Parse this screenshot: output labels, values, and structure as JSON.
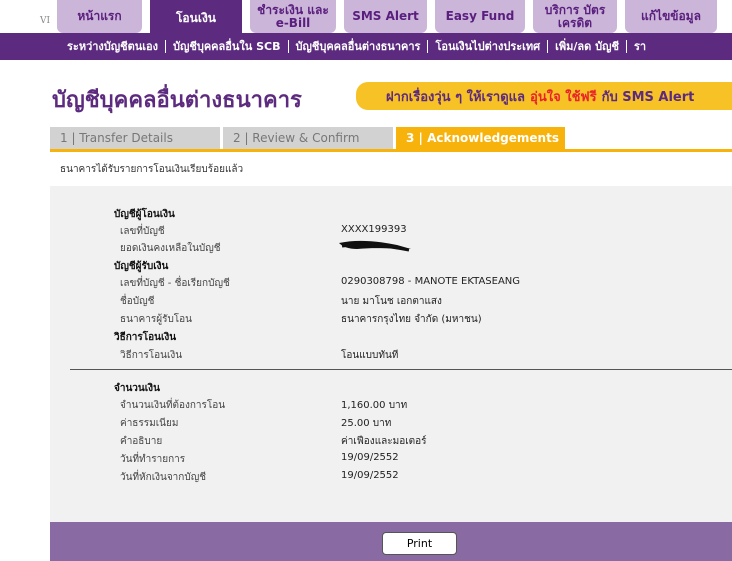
{
  "top_nav": {
    "corner_label": "VI",
    "tabs": [
      {
        "label": "หน้าแรก"
      },
      {
        "label": "โอนเงิน"
      },
      {
        "label": "ชำระเงิน และ e-Bill"
      },
      {
        "label": "SMS Alert"
      },
      {
        "label": "Easy Fund"
      },
      {
        "label": "บริการ บัตรเครดิต"
      },
      {
        "label": "แก้ไขข้อมูล"
      }
    ]
  },
  "sub_nav": {
    "items": [
      {
        "label": "ระหว่างบัญชีตนเอง"
      },
      {
        "label": "บัญชีบุคคลอื่นใน SCB"
      },
      {
        "label": "บัญชีบุคคลอื่นต่างธนาคาร"
      },
      {
        "label": "โอนเงินไปต่างประเทศ"
      },
      {
        "label": "เพิ่ม/ลด บัญชี"
      },
      {
        "label": "รา"
      }
    ]
  },
  "page_title": "บัญชีบุคคลอื่นต่างธนาคาร",
  "banner": {
    "text_before": "ฝากเรื่องวุ่น ๆ ให้เราดูแล",
    "highlight": "อุ่นใจ ใช้ฟรี",
    "text_after": "กับ SMS Alert"
  },
  "steps": [
    {
      "label": "1 | Transfer Details"
    },
    {
      "label": "2 | Review & Confirm"
    },
    {
      "label": "3 | Acknowledgements"
    }
  ],
  "success_message": "ธนาคารได้รับรายการโอนเงินเรียบร้อยแล้ว",
  "details": {
    "from_title": "บัญชีผู้โอนเงิน",
    "from_account_label": "เลขที่บัญชี",
    "from_account_value": "XXXX199393",
    "balance_label": "ยอดเงินคงเหลือในบัญชี",
    "to_title": "บัญชีผู้รับเงิน",
    "to_account_label": "เลขที่บัญชี - ชื่อเรียกบัญชี",
    "to_account_value": "0290308798 - MANOTE EKTASEANG",
    "account_name_label": "ชื่อบัญชี",
    "account_name_value": "นาย มาโนช เอกตาแสง",
    "bank_label": "ธนาคารผู้รับโอน",
    "bank_value": "ธนาคารกรุงไทย จำกัด (มหาชน)",
    "method_title": "วิธีการโอนเงิน",
    "method_label": "วิธีการโอนเงิน",
    "method_value": "โอนแบบทันที",
    "amount_title": "จำนวนเงิน",
    "amount_label": "จำนวนเงินที่ต้องการโอน",
    "amount_value": "1,160.00 บาท",
    "fee_label": "ค่าธรรมเนียม",
    "fee_value": "25.00 บาท",
    "desc_label": "คำอธิบาย",
    "desc_value": "ค่าเฟืองและมอเตอร์",
    "txn_date_label": "วันที่ทำรายการ",
    "txn_date_value": "19/09/2552",
    "debit_date_label": "วันที่หักเงินจากบัญชี",
    "debit_date_value": "19/09/2552"
  },
  "print_button": "Print",
  "colors": {
    "brand_purple": "#5c2a7e",
    "tab_lavender": "#cbb6d9",
    "accent_yellow": "#f7b30b",
    "bottom_bar": "#8a6aa3"
  }
}
